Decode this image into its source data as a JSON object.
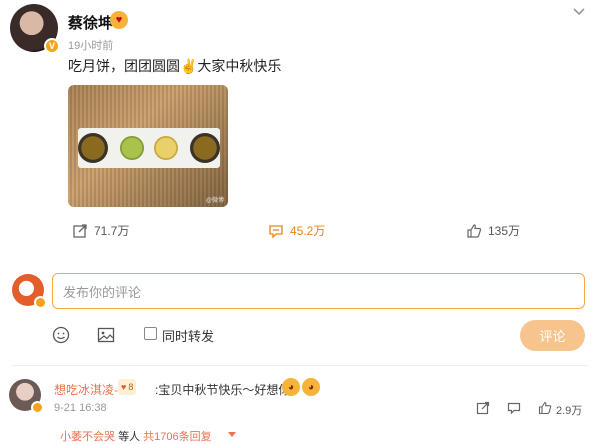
{
  "post": {
    "author": "蔡徐坤",
    "author_badge_emoji": "heart-eyes",
    "time": "19小时前",
    "text": "吃月饼，团团圆圆✌️大家中秋快乐",
    "image_watermark": "@微博"
  },
  "actions": {
    "repost_count": "71.7万",
    "comment_count": "45.2万",
    "like_count": "135万",
    "accent": "#f7a41b"
  },
  "composer": {
    "placeholder": "发布你的评论",
    "repost_label": "同时转发",
    "submit_label": "评论"
  },
  "comment": {
    "user": "想吃冰淇凌-",
    "badge": "8",
    "text": ":宝贝中秋节快乐～好想你",
    "time": "9-21 16:38",
    "likes": "2.9万",
    "replies": {
      "user": "小萎不会哭",
      "middle": "等人",
      "count": "共1706条回复"
    }
  }
}
